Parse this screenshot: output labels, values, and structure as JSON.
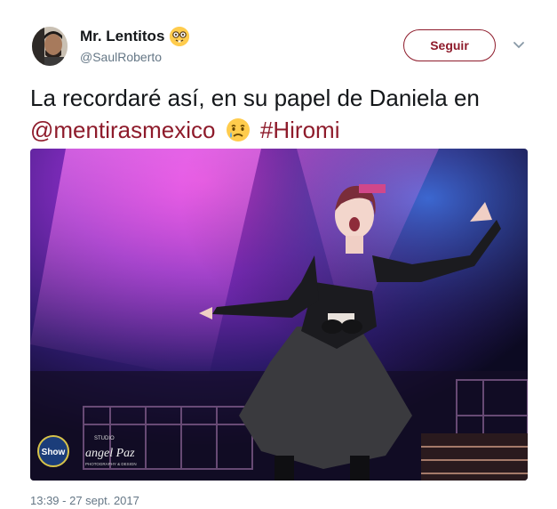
{
  "tweet": {
    "author_name": "Mr. Lentitos",
    "author_emoji_icon": "nerd-face-emoji",
    "author_handle": "@SaulRoberto",
    "follow_label": "Seguir",
    "text_before": "La recordaré así, en su papel de Daniela en",
    "mention": "@mentirasmexico",
    "emoji_icon": "crying-face-emoji",
    "hashtag": "#Hiromi",
    "timestamp": "13:39 - 27 sept. 2017",
    "media": {
      "watermark_left": "Show",
      "watermark_right": "angel Paz",
      "watermark_right_top": "STUDIO",
      "watermark_right_bottom": "PHOTOGRAPHY & DESIGN"
    }
  },
  "colors": {
    "link": "#8e1b2b",
    "secondary_text": "#657786"
  }
}
